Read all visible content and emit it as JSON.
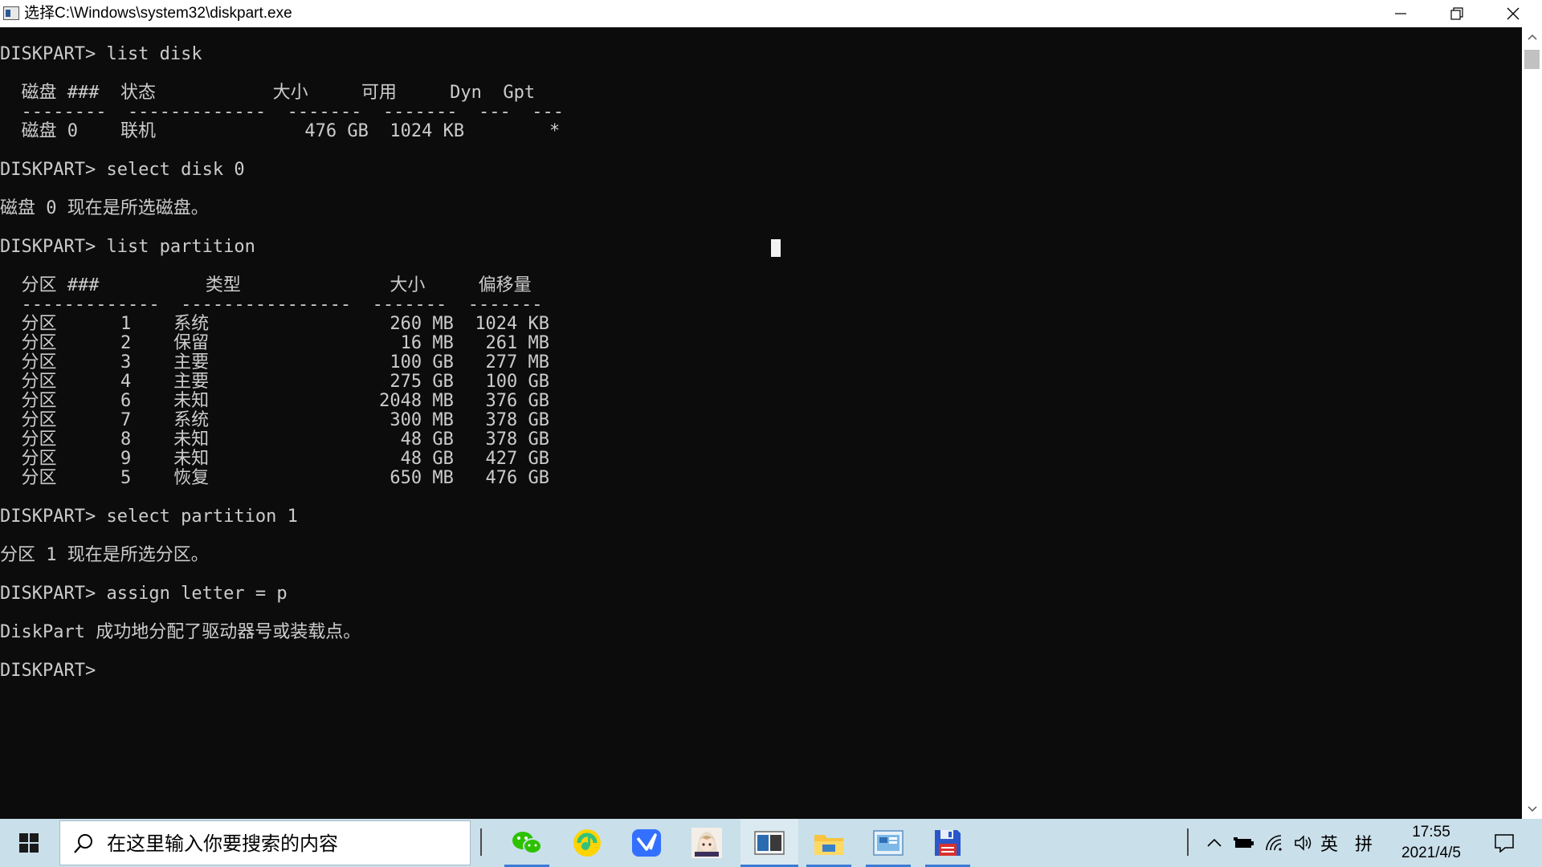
{
  "window": {
    "title": "选择C:\\Windows\\system32\\diskpart.exe",
    "buttons": [
      "minimize",
      "restore",
      "close"
    ]
  },
  "console": {
    "lines": [
      "DISKPART> list disk",
      "",
      "  磁盘 ###  状态           大小     可用     Dyn  Gpt",
      "  --------  -------------  -------  -------  ---  ---",
      "  磁盘 0    联机              476 GB  1024 KB        *",
      "",
      "DISKPART> select disk 0",
      "",
      "磁盘 0 现在是所选磁盘。",
      "",
      "DISKPART> list partition",
      "",
      "  分区 ###          类型              大小     偏移量",
      "  -------------  ----------------  -------  -------",
      "  分区      1    系统                 260 MB  1024 KB",
      "  分区      2    保留                  16 MB   261 MB",
      "  分区      3    主要                 100 GB   277 MB",
      "  分区      4    主要                 275 GB   100 GB",
      "  分区      6    未知                2048 MB   376 GB",
      "  分区      7    系统                 300 MB   378 GB",
      "  分区      8    未知                  48 GB   378 GB",
      "  分区      9    未知                  48 GB   427 GB",
      "  分区      5    恢复                 650 MB   476 GB",
      "",
      "DISKPART> select partition 1",
      "",
      "分区 1 现在是所选分区。",
      "",
      "DISKPART> assign letter = p",
      "",
      "DiskPart 成功地分配了驱动器号或装载点。",
      "",
      "DISKPART> "
    ]
  },
  "taskbar": {
    "search_placeholder": "在这里输入你要搜索的内容",
    "apps": [
      {
        "name": "wechat-icon",
        "active": false
      },
      {
        "name": "qq-music-icon",
        "active": false
      },
      {
        "name": "feishu-icon",
        "active": false
      },
      {
        "name": "anime-avatar-icon",
        "active": false
      },
      {
        "name": "cmd-icon",
        "active": true
      },
      {
        "name": "file-explorer-icon",
        "active": false
      },
      {
        "name": "control-panel-icon",
        "active": false
      },
      {
        "name": "floppy-disk-icon",
        "active": false
      }
    ],
    "tray": {
      "ime_language": "英",
      "ime_mode": "拼",
      "time": "17:55",
      "date": "2021/4/5"
    }
  },
  "colors": {
    "console_bg": "#0c0c0c",
    "console_fg": "#cccccc",
    "taskbar_bg": "#c9dfea",
    "accent": "#3a7bd5"
  }
}
